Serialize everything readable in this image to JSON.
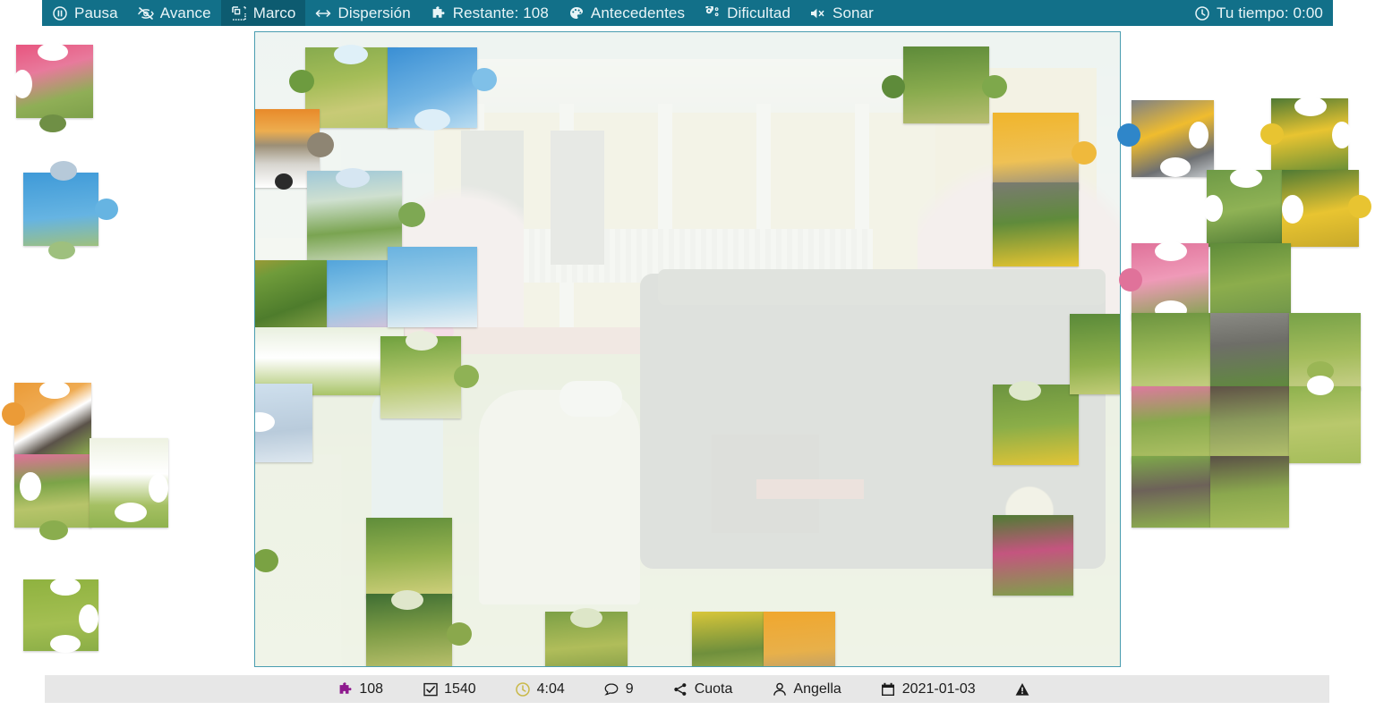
{
  "toolbar": {
    "background_color": "#127089",
    "active_color": "#0d5b70",
    "items": [
      {
        "id": "pausa",
        "label": "Pausa",
        "icon": "pause-circle-icon",
        "active": false
      },
      {
        "id": "avance",
        "label": "Avance",
        "icon": "eye-slash-icon",
        "active": false
      },
      {
        "id": "marco",
        "label": "Marco",
        "icon": "frame-icon",
        "active": true
      },
      {
        "id": "dispersion",
        "label": "Dispersión",
        "icon": "arrows-h-icon",
        "active": false
      },
      {
        "id": "restante",
        "label": "Restante: 108",
        "icon": "puzzle-piece-icon",
        "active": false
      },
      {
        "id": "antecedentes",
        "label": "Antecedentes",
        "icon": "palette-icon",
        "active": false
      },
      {
        "id": "dificultad",
        "label": "Dificultad",
        "icon": "sliders-icon",
        "active": false
      },
      {
        "id": "sonar",
        "label": "Sonar",
        "icon": "volume-mute-icon",
        "active": false
      }
    ],
    "timer": {
      "label": "Tu tiempo: 0:00",
      "icon": "clock-icon"
    }
  },
  "statusbar": {
    "background_color": "#e7e7e7",
    "items": [
      {
        "id": "pieces",
        "icon": "puzzle-piece-icon",
        "icon_color": "#8e1a8e",
        "value": "108"
      },
      {
        "id": "solved",
        "icon": "check-square-icon",
        "icon_color": "#1c1c1c",
        "value": "1540"
      },
      {
        "id": "besttime",
        "icon": "clock-icon",
        "icon_color": "#c9b949",
        "value": "4:04"
      },
      {
        "id": "comments",
        "icon": "comment-icon",
        "icon_color": "#1c1c1c",
        "value": "9"
      },
      {
        "id": "share",
        "icon": "share-icon",
        "icon_color": "#1c1c1c",
        "value": "Cuota"
      },
      {
        "id": "author",
        "icon": "user-icon",
        "icon_color": "#1c1c1c",
        "value": "Angella"
      },
      {
        "id": "date",
        "icon": "calendar-icon",
        "icon_color": "#1c1c1c",
        "value": "2021-01-03"
      },
      {
        "id": "report",
        "icon": "warning-icon",
        "icon_color": "#1c1c1c",
        "value": ""
      }
    ]
  },
  "board": {
    "border_color": "#4a9db0",
    "background_color": "#f4f7f2",
    "reference_opacity": "0.10",
    "description": "Faded reference image of a vintage Ford automobile in front of a yellow Victorian house with pink flowering trees, tulips and a white picket fence"
  },
  "pieces": {
    "count_remaining": 108,
    "total": 1540,
    "tray_note": "Scattered jigsaw pieces showing fragments of sky, grass, yellow siding, pink and yellow flowers, white fence and gravel path"
  }
}
